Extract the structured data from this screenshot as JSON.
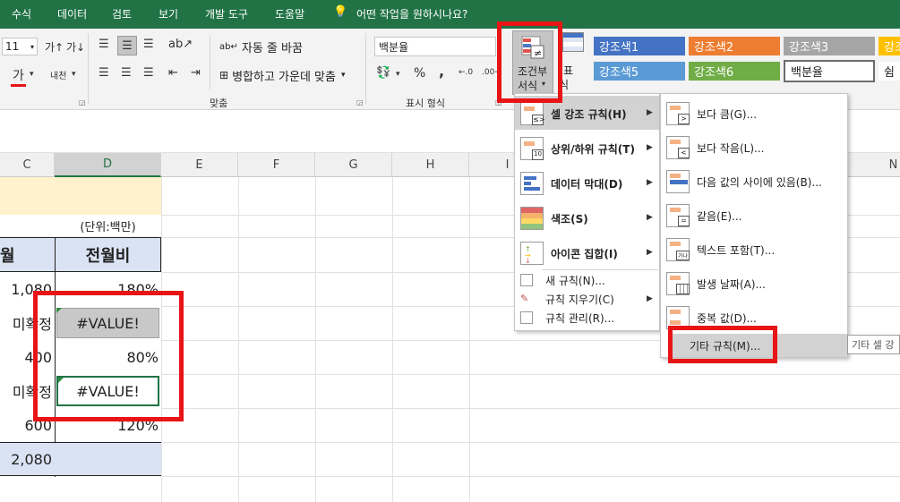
{
  "menubar": {
    "tabs": [
      "수식",
      "데이터",
      "검토",
      "보기",
      "개발 도구",
      "도움말"
    ],
    "tell_me": "어떤 작업을 원하시나요?"
  },
  "ribbon": {
    "font_size": "11",
    "wrap_text": "자동 줄 바꿈",
    "merge_center": "병합하고 가운데 맞춤",
    "align_group": "맞춤",
    "number_format": "백분율",
    "number_group": "표시 형식",
    "cond_format_line1": "조건부",
    "cond_format_line2": "서식",
    "table_line1": "표",
    "table_line2": "식",
    "percent": "%",
    "comma": ",",
    "styles": [
      "강조색1",
      "강조색2",
      "강조색3",
      "강조",
      "강조색5",
      "강조색6",
      "백분율",
      "쉼"
    ],
    "style_colors": [
      "#4472c4",
      "#ed7d31",
      "#a5a5a5",
      "#ffc000",
      "#5b9bd5",
      "#70ad47",
      "#ffffff",
      "#ffffff"
    ]
  },
  "columns": [
    "C",
    "D",
    "E",
    "F",
    "G",
    "H",
    "I",
    "N"
  ],
  "sheet": {
    "unit": "(단위:백만)",
    "header_c": "월",
    "header_d": "전월비",
    "c_values": [
      "1,080",
      "미확정",
      "400",
      "미확정",
      "600",
      "2,080"
    ],
    "d_values": [
      "180%",
      "#VALUE!",
      "80%",
      "#VALUE!",
      "120%",
      ""
    ]
  },
  "cf_menu": {
    "items": [
      "셀 강조 규칙(H)",
      "상위/하위 규칙(T)",
      "데이터 막대(D)",
      "색조(S)",
      "아이콘 집합(I)"
    ],
    "simple_items": [
      "새 규칙(N)...",
      "규칙 지우기(C)",
      "규칙 관리(R)..."
    ]
  },
  "submenu": {
    "items": [
      "보다 큼(G)...",
      "보다 작음(L)...",
      "다음 값의 사이에 있음(B)...",
      "같음(E)...",
      "텍스트 포함(T)...",
      "발생 날짜(A)...",
      "중복 값(D)..."
    ],
    "other": "기타 규칙(M)...",
    "tooltip": "기타 셀 강"
  }
}
